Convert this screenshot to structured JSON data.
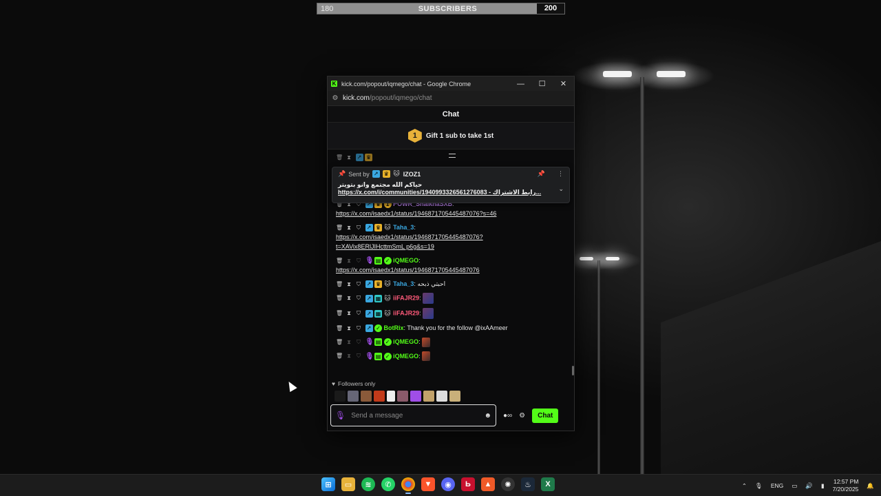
{
  "subscriber_goal": {
    "current": "180",
    "label": "SUBSCRIBERS",
    "target": "200",
    "progress_fraction": 0.9
  },
  "window": {
    "title": "kick.com/popout/iqmego/chat - Google Chrome",
    "url_host": "kick.com",
    "url_path": "/popout/iqmego/chat",
    "minimize": "—",
    "maximize": "☐",
    "close": "✕"
  },
  "chat": {
    "header": "Chat",
    "gift_rank": "1",
    "gift_text": "Gift 1 sub to take 1st",
    "pinned": {
      "sent_by_label": "Sent by",
      "user": "IZOZ1",
      "arabic_text": "حياكم الله مجتمع وانو بتويتر",
      "link_text": "https://x.com/i/communities/1940993326561276083 - رابط الاشتراك..."
    },
    "messages": [
      {
        "user": "POWR_ShaikhaSXB",
        "color": "#c58af9",
        "link": "https://x.com/isaedx1/status/1946871705445487076?s=46"
      },
      {
        "user": "Taha_3",
        "color": "#3aa7e0",
        "link": "https://x.com/isaedx1/status/1946871705445487076?",
        "link2": "t=XAVix8ERlJIHcttmSmL p6g&s=19"
      },
      {
        "user": "iQMEGO",
        "color": "#53fc18",
        "link": "https://x.com/isaedx1/status/1946871705445487076"
      },
      {
        "user": "Taha_3",
        "color": "#3aa7e0",
        "text": "احبتي ذبحه"
      },
      {
        "user": "iiFAJR29",
        "color": "#ff5a7a"
      },
      {
        "user": "iiFAJR29",
        "color": "#ff5a7a"
      },
      {
        "user": "BotRix",
        "color": "#53fc18",
        "text": "Thank you for the follow @ixAAmeer"
      },
      {
        "user": "iQMEGO",
        "color": "#53fc18"
      },
      {
        "user": "iQMEGO",
        "color": "#53fc18"
      }
    ],
    "followers_only": "Followers only",
    "input_placeholder": "Send a message",
    "send_button": "Chat"
  },
  "taskbar": {
    "language": "ENG",
    "time": "12:57 PM",
    "date": "7/20/2025"
  },
  "colors": {
    "kick_green": "#53fc18",
    "accent_purple": "#a04ee8",
    "gold": "#e9b22a"
  }
}
